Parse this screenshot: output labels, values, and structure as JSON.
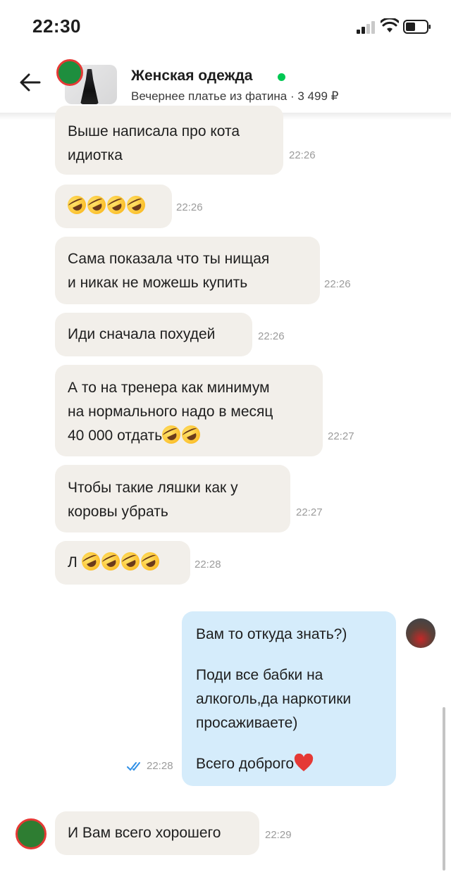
{
  "status_bar": {
    "time": "22:30"
  },
  "header": {
    "seller_name": "Женская одежда",
    "ad_subtitle": "Вечернее платье из фатина · 3 499 ₽"
  },
  "messages": [
    {
      "text": [
        "Выше написала про кота",
        "идиотка"
      ],
      "time": "22:26"
    },
    {
      "emoji_count": 4,
      "time": "22:26"
    },
    {
      "text": [
        "Сама показала что  ты нищая",
        "и никак не можешь купить"
      ],
      "time": "22:26"
    },
    {
      "text": [
        "Иди сначала похудей"
      ],
      "time": "22:26"
    },
    {
      "text": [
        "А то на тренера как минимум",
        "на нормального надо в месяц",
        "40 000 отдать"
      ],
      "emoji_count": 2,
      "time": "22:27"
    },
    {
      "text": [
        "Чтобы такие ляшки  как у",
        "коровы убрать"
      ],
      "time": "22:27"
    },
    {
      "text": [
        "Л"
      ],
      "emoji_count": 4,
      "time": "22:28"
    }
  ],
  "outgoing": {
    "lines": [
      "Вам то откуда знать?)",
      "Поди все бабки на",
      "алкоголь,да наркотики",
      "просаживаете)",
      "Всего доброго"
    ],
    "time": "22:28",
    "read": true
  },
  "last_message": {
    "text": "И Вам всего хорошего",
    "time": "22:29"
  },
  "colors": {
    "incoming_bubble": "#f2efea",
    "outgoing_bubble": "#d5ecfb",
    "online": "#00c853",
    "read_check": "#2f8fe6"
  }
}
